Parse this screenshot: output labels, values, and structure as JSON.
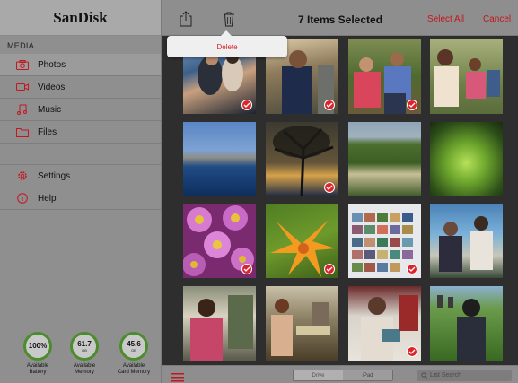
{
  "brand": "SanDisk",
  "sidebar": {
    "section_label": "MEDIA",
    "media_items": [
      {
        "label": "Photos",
        "icon": "camera-icon",
        "active": true
      },
      {
        "label": "Videos",
        "icon": "video-camera-icon",
        "active": false
      },
      {
        "label": "Music",
        "icon": "music-note-icon",
        "active": false
      },
      {
        "label": "Files",
        "icon": "folder-icon",
        "active": false
      }
    ],
    "settings_label": "Settings",
    "help_label": "Help"
  },
  "gauges": [
    {
      "value": "100%",
      "unit": "",
      "caption_line1": "Available",
      "caption_line2": "Battery"
    },
    {
      "value": "61.7",
      "unit": "GB",
      "caption_line1": "Available",
      "caption_line2": "Memory"
    },
    {
      "value": "45.6",
      "unit": "GB",
      "caption_line1": "Available",
      "caption_line2": "Card Memory"
    }
  ],
  "topbar": {
    "title": "7 Items Selected",
    "select_all": "Select All",
    "cancel": "Cancel"
  },
  "popover": {
    "delete": "Delete"
  },
  "photos": [
    {
      "selected": true
    },
    {
      "selected": true
    },
    {
      "selected": true
    },
    {
      "selected": false
    },
    {
      "selected": false
    },
    {
      "selected": true
    },
    {
      "selected": false
    },
    {
      "selected": false
    },
    {
      "selected": true
    },
    {
      "selected": true
    },
    {
      "selected": true
    },
    {
      "selected": false
    },
    {
      "selected": false
    },
    {
      "selected": false
    },
    {
      "selected": true
    },
    {
      "selected": false
    }
  ],
  "bottombar": {
    "segment_drive": "Drive",
    "segment_ipad": "iPad",
    "search_placeholder": "List Search"
  },
  "colors": {
    "accent_red": "#c4161c",
    "gauge_green": "#4c8c2c"
  }
}
